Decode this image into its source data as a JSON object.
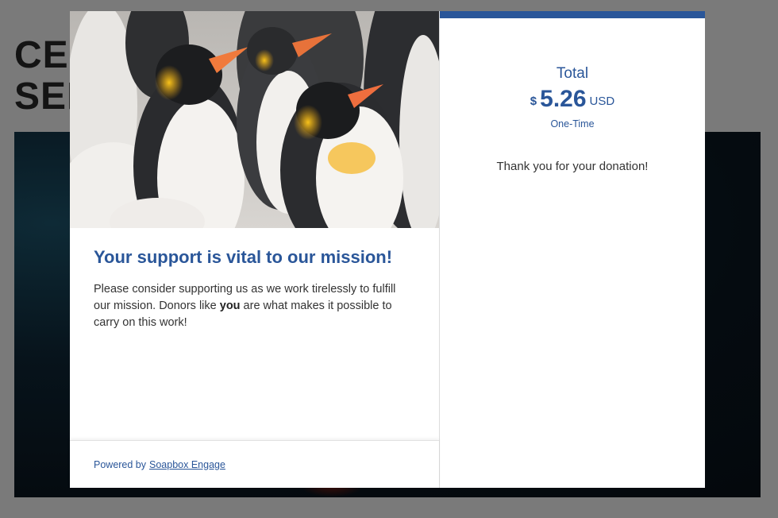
{
  "background_page": {
    "title_line1": "CE",
    "title_line2": "SEF"
  },
  "modal": {
    "left": {
      "image_alt": "King penguins",
      "heading": "Your support is vital to our mission!",
      "body_part1": "Please consider supporting us as we work tirelessly to fulfill our mission. Donors like ",
      "body_bold": "you",
      "body_part2": " are what makes it possible to carry on this work!",
      "footer_prefix": "Powered by",
      "footer_link": "Soapbox Engage"
    },
    "right": {
      "total_label": "Total",
      "currency_symbol": "$",
      "amount": "5.26",
      "currency_code": "USD",
      "frequency": "One-Time",
      "thanks": "Thank you for your donation!"
    }
  },
  "colors": {
    "accent": "#2a5699",
    "overlay": "#7a7a7a",
    "text": "#333333"
  }
}
